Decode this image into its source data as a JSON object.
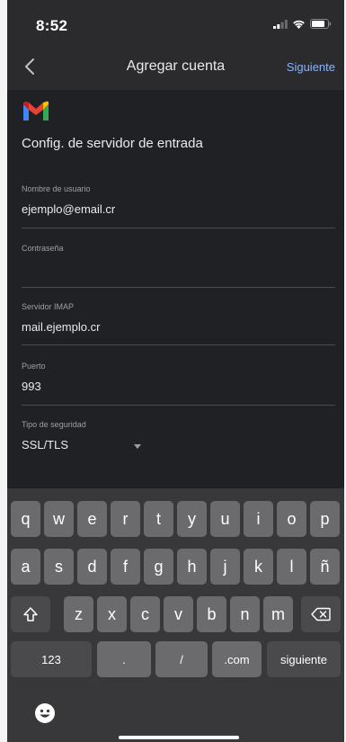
{
  "status_bar": {
    "time": "8:52"
  },
  "nav": {
    "title": "Agregar cuenta",
    "next_label": "Siguiente"
  },
  "form": {
    "section_title": "Config. de servidor de entrada",
    "username": {
      "label": "Nombre de usuario",
      "value": "ejemplo@email.cr"
    },
    "password": {
      "label": "Contraseña",
      "value": ""
    },
    "imap_server": {
      "label": "Servidor IMAP",
      "value": "mail.ejemplo.cr"
    },
    "port": {
      "label": "Puerto",
      "value": "993"
    },
    "security_type": {
      "label": "Tipo de seguridad",
      "value": "SSL/TLS"
    }
  },
  "keyboard": {
    "row1": [
      "q",
      "w",
      "e",
      "r",
      "t",
      "y",
      "u",
      "i",
      "o",
      "p"
    ],
    "row2": [
      "a",
      "s",
      "d",
      "f",
      "g",
      "h",
      "j",
      "k",
      "l",
      "ñ"
    ],
    "row3": [
      "z",
      "x",
      "c",
      "v",
      "b",
      "n",
      "m"
    ],
    "bottom": {
      "numbers": "123",
      "dot": ".",
      "slash": "/",
      "dotcom": ".com",
      "return": "siguiente"
    },
    "icons": {
      "shift": "shift-icon",
      "delete": "backspace-icon",
      "emoji": "emoji-icon"
    }
  },
  "colors": {
    "background": "#202124",
    "accent": "#8ab4f8",
    "gmail_red": "#ea4335"
  }
}
